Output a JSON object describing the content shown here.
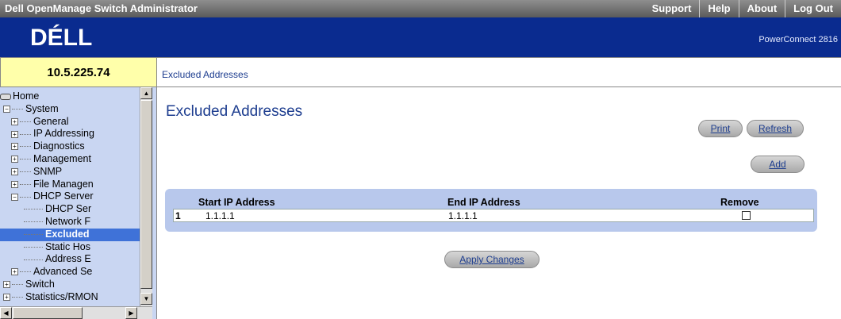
{
  "header": {
    "app_title": "Dell OpenManage Switch Administrator",
    "links": [
      "Support",
      "Help",
      "About",
      "Log Out"
    ]
  },
  "banner": {
    "logo_text": "DÉLL",
    "product": "PowerConnect 2816"
  },
  "device_ip": "10.5.225.74",
  "breadcrumb": "Excluded Addresses",
  "sidebar": {
    "tree": [
      {
        "label": "Home",
        "level": 0,
        "icon": "home"
      },
      {
        "label": "System",
        "level": 1,
        "toggle": "−"
      },
      {
        "label": "General",
        "level": 2,
        "toggle": "+"
      },
      {
        "label": "IP Addressing",
        "level": 2,
        "toggle": "+"
      },
      {
        "label": "Diagnostics",
        "level": 2,
        "toggle": "+"
      },
      {
        "label": "Management",
        "level": 2,
        "toggle": "+"
      },
      {
        "label": "SNMP",
        "level": 2,
        "toggle": "+"
      },
      {
        "label": "File Managen",
        "level": 2,
        "toggle": "+"
      },
      {
        "label": "DHCP Server",
        "level": 2,
        "toggle": "−"
      },
      {
        "label": "DHCP Ser",
        "level": 3
      },
      {
        "label": "Network F",
        "level": 3
      },
      {
        "label": "Excluded",
        "level": 3,
        "selected": true
      },
      {
        "label": "Static Hos",
        "level": 3
      },
      {
        "label": "Address E",
        "level": 3
      },
      {
        "label": "Advanced Se",
        "level": 2,
        "toggle": "+"
      },
      {
        "label": "Switch",
        "level": 1,
        "toggle": "+"
      },
      {
        "label": "Statistics/RMON",
        "level": 1,
        "toggle": "+"
      }
    ]
  },
  "main": {
    "title": "Excluded Addresses",
    "buttons": {
      "print": "Print",
      "refresh": "Refresh",
      "add": "Add",
      "apply": "Apply Changes"
    },
    "table": {
      "headers": {
        "start": "Start IP Address",
        "end": "End IP Address",
        "remove": "Remove"
      },
      "rows": [
        {
          "index": "1",
          "start": "1.1.1.1",
          "end": "1.1.1.1",
          "remove": false
        }
      ]
    }
  },
  "colors": {
    "banner": "#0a2b8f",
    "sidebar": "#c9d6f2",
    "accent_text": "#1d3d8f",
    "selected": "#3f72d8",
    "ip_box": "#ffffaa"
  }
}
